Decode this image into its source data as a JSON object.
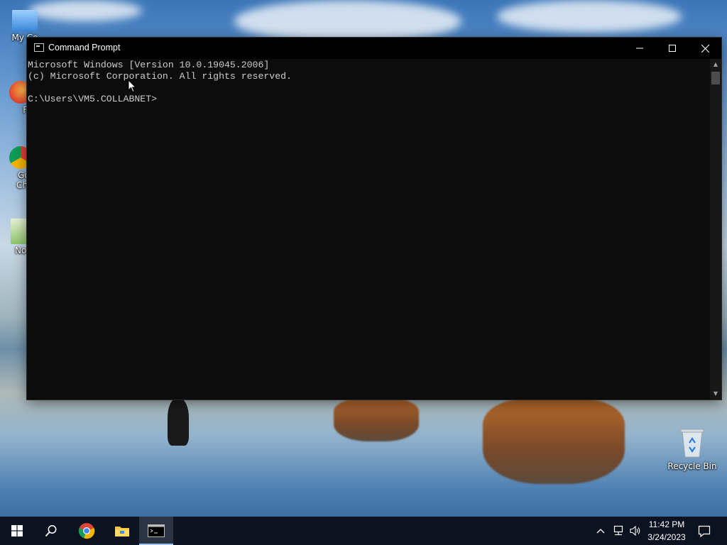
{
  "desktop": {
    "icons": [
      {
        "label": "My Co"
      },
      {
        "label": "Fire"
      },
      {
        "label": "Goo Chro"
      },
      {
        "label": "Notep"
      },
      {
        "label": "Recycle Bin"
      }
    ]
  },
  "cmd_window": {
    "title": "Command Prompt",
    "lines": [
      "Microsoft Windows [Version 10.0.19045.2006]",
      "(c) Microsoft Corporation. All rights reserved.",
      "",
      "C:\\Users\\VM5.COLLABNET>"
    ]
  },
  "taskbar": {
    "clock_time": "11:42 PM",
    "clock_date": "3/24/2023"
  },
  "icons": {
    "start": "windows-start-icon",
    "search": "search-icon",
    "chrome": "chrome-icon",
    "explorer": "file-explorer-icon",
    "cmd": "command-prompt-icon"
  },
  "colors": {
    "taskbar_bg": "#0b1320",
    "console_bg": "#0c0c0c",
    "console_text": "#cccccc",
    "accent": "#9ec3ec"
  }
}
